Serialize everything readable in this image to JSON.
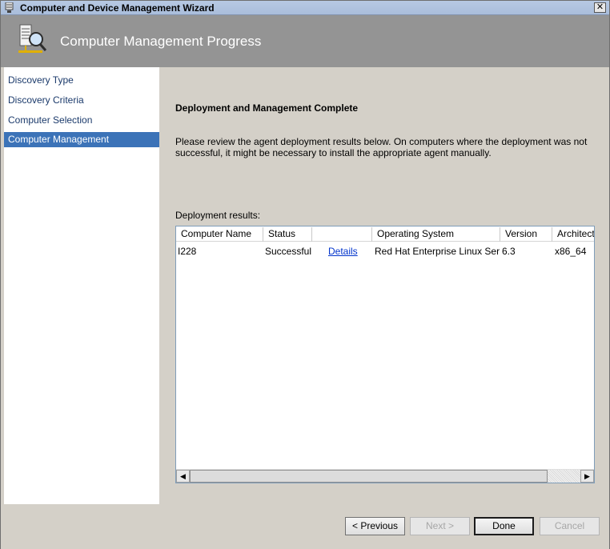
{
  "window": {
    "title": "Computer and Device Management Wizard",
    "close_label": "✕"
  },
  "banner": {
    "title": "Computer Management Progress"
  },
  "sidebar": {
    "items": [
      {
        "label": "Discovery Type"
      },
      {
        "label": "Discovery Criteria"
      },
      {
        "label": "Computer Selection"
      },
      {
        "label": "Computer Management"
      }
    ],
    "active_index": 3
  },
  "main": {
    "heading": "Deployment and Management Complete",
    "description": "Please review the agent deployment results below. On computers where the deployment was not successful, it might be necessary to install the appropriate agent manually.",
    "results_label": "Deployment results:"
  },
  "results_table": {
    "columns": [
      "Computer Name",
      "Status",
      "",
      "Operating System",
      "Version",
      "Architectu"
    ],
    "rows": [
      {
        "computer_name": "I228",
        "status": "Successful",
        "details": "Details",
        "os": "Red Hat Enterprise Linux Server",
        "version": "6.3",
        "architecture": "x86_64"
      }
    ]
  },
  "scrollbar": {
    "left_arrow": "◀",
    "right_arrow": "▶"
  },
  "buttons": {
    "previous": "< Previous",
    "next": "Next >",
    "done": "Done",
    "cancel": "Cancel"
  },
  "colors": {
    "banner": "#949494",
    "selected": "#3c73b8",
    "link": "#0033cc"
  }
}
